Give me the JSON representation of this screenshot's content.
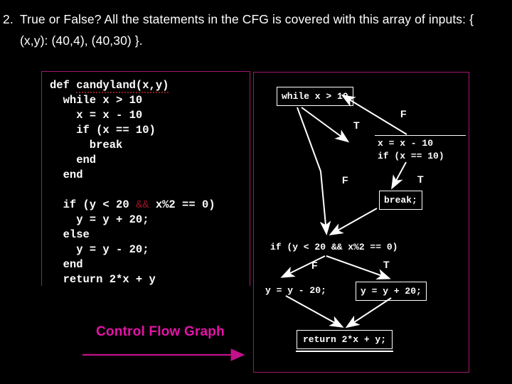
{
  "question": {
    "number": "2.",
    "text": "True or False? All the statements in the CFG is covered with this array of inputs: { (x,y): (40,4), (40,30) }."
  },
  "code_panel": {
    "name": "source-code-listing",
    "signature": "def candyland(x,y)",
    "lines": [
      "def candyland(x,y)",
      "  while x > 10",
      "    x = x - 10",
      "    if (x == 10)",
      "      break",
      "    end",
      "  end",
      "",
      "  if (y < 20 && x%2 == 0)",
      "    y = y + 20;",
      "  else",
      "    y = y - 20;",
      "  end",
      "  return 2*x + y"
    ]
  },
  "cfg_label": {
    "text": "Control Flow Graph",
    "color": "#e413a7"
  },
  "cfg": {
    "nodes": [
      {
        "id": "while",
        "text": "while x > 10",
        "style": "boxed"
      },
      {
        "id": "xassign",
        "text": "x = x - 10\nif (x == 10)",
        "style": "topline"
      },
      {
        "id": "break",
        "text": "break;",
        "style": "boxed"
      },
      {
        "id": "if",
        "text": "if (y < 20 && x%2 == 0)",
        "style": "plain"
      },
      {
        "id": "yminus",
        "text": "y = y - 20;",
        "style": "plain"
      },
      {
        "id": "yplus",
        "text": "y = y + 20;",
        "style": "boxed"
      },
      {
        "id": "return",
        "text": "return 2*x + y;",
        "style": "terminal"
      }
    ],
    "edge_labels": {
      "t1": "T",
      "f1": "F",
      "t2": "T",
      "f2": "F",
      "f3": "F",
      "t3": "T"
    }
  },
  "colors": {
    "background": "#000000",
    "panel_border": "#a01a6e",
    "accent": "#e413a7",
    "text": "#ffffff",
    "operator_highlight": "#7a1020"
  }
}
